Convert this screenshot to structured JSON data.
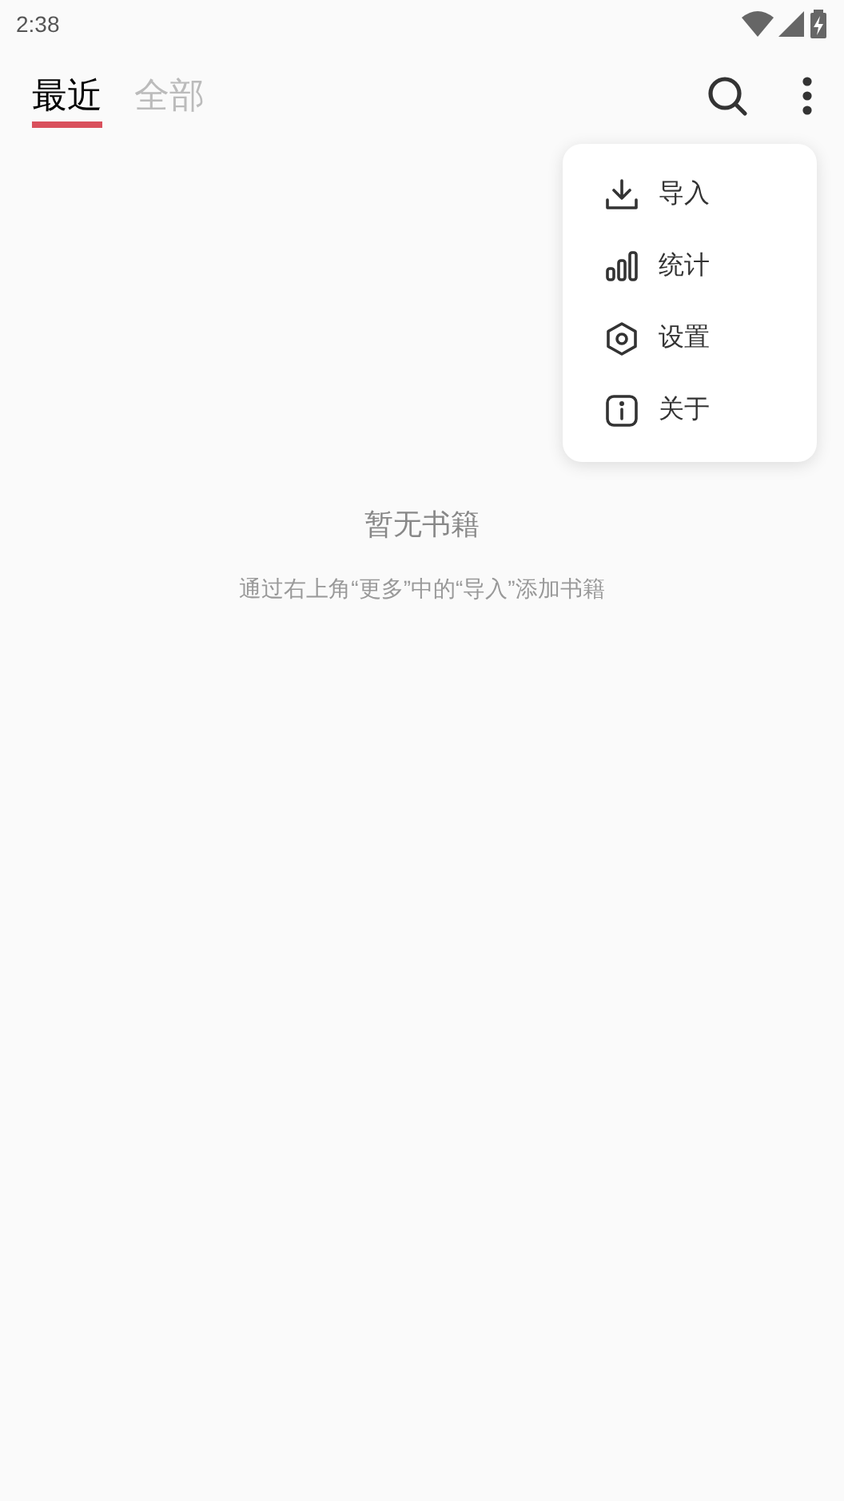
{
  "status_bar": {
    "time": "2:38"
  },
  "tabs": [
    {
      "label": "最近",
      "selected": true
    },
    {
      "label": "全部",
      "selected": false
    }
  ],
  "menu": [
    {
      "kind": "import",
      "label": "导入"
    },
    {
      "kind": "stats",
      "label": "统计"
    },
    {
      "kind": "settings",
      "label": "设置"
    },
    {
      "kind": "about",
      "label": "关于"
    }
  ],
  "empty_state": {
    "title": "暂无书籍",
    "hint": "通过右上角“更多”中的“导入”添加书籍"
  }
}
